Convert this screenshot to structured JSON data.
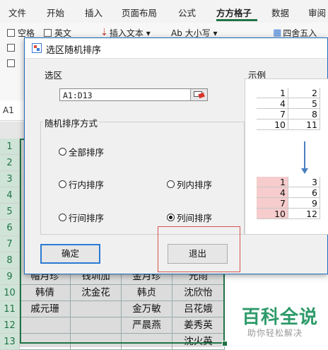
{
  "ribbon": {
    "tabs": [
      "文件",
      "开始",
      "插入",
      "页面布局",
      "公式",
      "方方格子",
      "数据",
      "审阅"
    ],
    "active_tab": "方方格子",
    "checkbox_space": "空格",
    "checkbox_english": "英文",
    "insert_text": "插入文本 ▾",
    "case_label": "Ab 大小写 ▾",
    "round_label": "四舍五入"
  },
  "formula_bar": {
    "name_box": "A1"
  },
  "sheet": {
    "row_numbers": [
      "1",
      "2",
      "3",
      "4",
      "5",
      "6",
      "7",
      "8",
      "9",
      "10",
      "11",
      "12",
      "13"
    ],
    "row_9": [
      "帽月珍",
      "钱圳加",
      "金月珍",
      "元雨"
    ],
    "row_10": [
      "韩倩",
      "沈金花",
      "韩贞",
      "沈欣怡"
    ],
    "row_11": [
      "戚元珊",
      "",
      "金万敏",
      "吕花娥"
    ],
    "row_12": [
      "",
      "",
      "严晨燕",
      "姜秀英"
    ],
    "row_13": [
      "",
      "",
      "",
      "沈火英"
    ]
  },
  "dialog": {
    "title": "选区随机排序",
    "range_label": "选区",
    "range_value": "A1:D13",
    "method_label": "随机排序方式",
    "options": {
      "all": "全部排序",
      "in_row": "行内排序",
      "in_col": "列内排序",
      "between_rows": "行间排序",
      "between_cols": "列间排序"
    },
    "selected_option": "between_cols",
    "ok_label": "确定",
    "exit_label": "退出",
    "example_label": "示例",
    "example_top": [
      [
        "1",
        "2"
      ],
      [
        "4",
        "5"
      ],
      [
        "7",
        "8"
      ],
      [
        "10",
        "11"
      ]
    ],
    "example_bottom": [
      [
        "1",
        "3"
      ],
      [
        "4",
        "6"
      ],
      [
        "7",
        "9"
      ],
      [
        "10",
        "12"
      ]
    ]
  },
  "watermark": {
    "title": "百科全说",
    "subtitle": "助你轻松解决"
  },
  "colors": {
    "accent": "#217346",
    "dialog_border": "#1c6dbb",
    "highlight": "#d9534f",
    "pink_cell": "#f6cccc"
  }
}
